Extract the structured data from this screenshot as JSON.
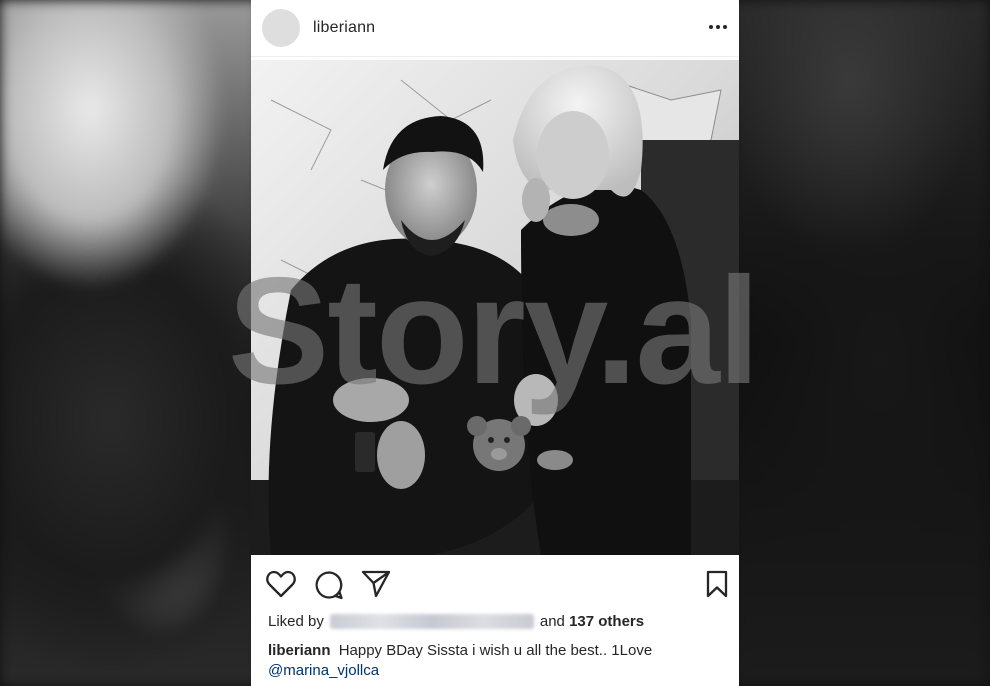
{
  "post": {
    "username": "liberiann",
    "more_icon": "more-horizontal-icon",
    "actions": {
      "like_icon": "heart-icon",
      "comment_icon": "comment-icon",
      "share_icon": "paper-plane-icon",
      "save_icon": "bookmark-icon"
    },
    "likes": {
      "prefix": "Liked by",
      "connector": "and",
      "count_text": "137 others"
    },
    "caption": {
      "username": "liberiann",
      "text": "Happy BDay Sissta i wish u all the best.. 1Love",
      "mention": "@marina_vjollca"
    }
  },
  "watermark": {
    "text": "Story.al"
  }
}
